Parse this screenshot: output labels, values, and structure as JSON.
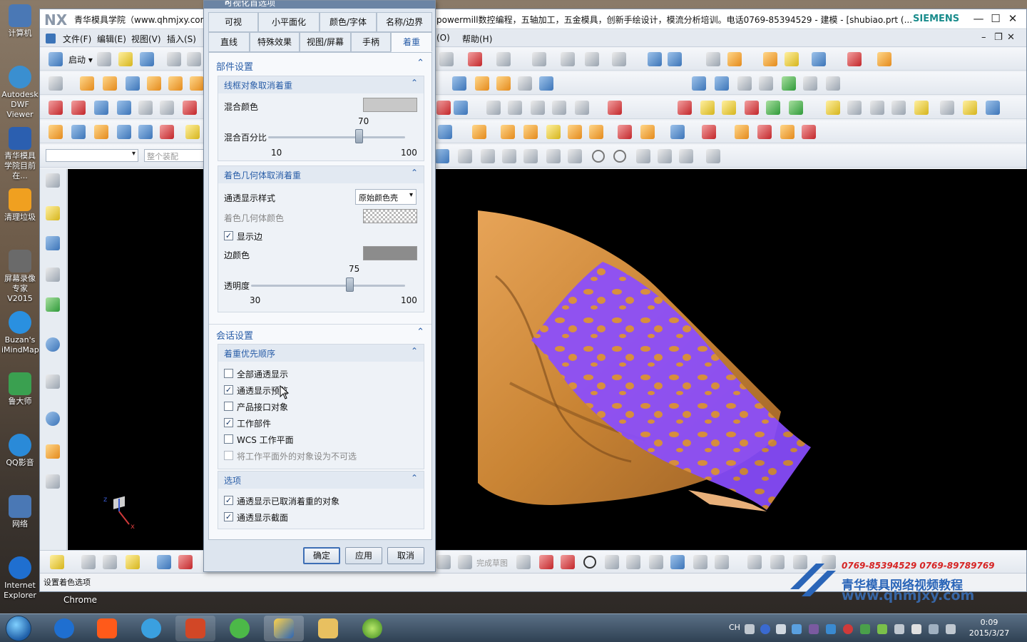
{
  "desktop": {
    "icons": [
      {
        "label": "计算机",
        "color": "#4a78b5"
      },
      {
        "label": "Autodesk DWF Viewer",
        "color": "#3a8fd0"
      },
      {
        "label": "青华模具学院目前在...",
        "color": "#2b5fb0"
      },
      {
        "label": "清理垃圾",
        "color": "#f0a020"
      },
      {
        "label": "屏幕录像专家V2015",
        "color": "#6a6a6a"
      },
      {
        "label": "Buzan's iMindMap",
        "color": "#2a90e0"
      },
      {
        "label": "鲁大师",
        "color": "#3aa050"
      },
      {
        "label": "QQ影音",
        "color": "#2a8ad8"
      },
      {
        "label": "网络",
        "color": "#4a78b5"
      },
      {
        "label": "Internet Explorer",
        "color": "#1f6fd0"
      }
    ],
    "chrome_label": "Chrome"
  },
  "window": {
    "logo": "NX",
    "title_left": "青华模具学院（www.qhmjxy.com",
    "title_right": "powermill数控编程，五轴加工，五金模具，创新手绘设计，模流分析培训。电话0769-85394529 - 建模 - [shubiao.prt  (...",
    "brand": "SIEMENS",
    "min": "—",
    "max": "☐",
    "close": "✕"
  },
  "menu": [
    "文件(F)",
    "编辑(E)",
    "视图(V)",
    "插入(S)"
  ],
  "menu_right": [
    "(O)",
    "帮助(H)"
  ],
  "toolbar": {
    "start_label": "启动 ▾",
    "assembly_placeholder": "整个装配",
    "bottom_sketch_label": "完成草图"
  },
  "status": {
    "text": "设置着色选项"
  },
  "dialog": {
    "title": "可视化首选项",
    "close": "✕",
    "tabs_row1": [
      "可视",
      "小平面化",
      "颜色/字体",
      "名称/边界"
    ],
    "tabs_row2": [
      "直线",
      "特殊效果",
      "视图/屏幕",
      "手柄",
      "着重"
    ],
    "active_tab": "着重",
    "section_part": "部件设置",
    "wire_group": {
      "title": "线框对象取消着重",
      "blend_color_label": "混合颜色",
      "blend_color": "#c8c8c8",
      "blend_pct_label": "混合百分比",
      "blend_value": "70",
      "blend_min": "10",
      "blend_max": "100",
      "blend_fraction": 0.667
    },
    "shade_group": {
      "title": "着色几何体取消着重",
      "style_label": "通透显示样式",
      "style_value": "原始颜色壳",
      "color_label": "着色几何体颜色",
      "show_edges_label": "显示边",
      "edge_color_label": "边颜色",
      "edge_color": "#8c8c8c",
      "transparency_label": "透明度",
      "transparency_value": "75",
      "transparency_min": "30",
      "transparency_max": "100",
      "transparency_fraction": 0.643
    },
    "section_session": "会话设置",
    "priority_group": {
      "title": "着重优先顺序",
      "items": [
        {
          "label": "全部通透显示",
          "checked": false,
          "disabled": false
        },
        {
          "label": "通透显示预览",
          "checked": true,
          "disabled": false
        },
        {
          "label": "产品接口对象",
          "checked": false,
          "disabled": false
        },
        {
          "label": "工作部件",
          "checked": true,
          "disabled": false
        },
        {
          "label": "WCS 工作平面",
          "checked": false,
          "disabled": false
        },
        {
          "label": "将工作平面外的对象设为不可选",
          "checked": false,
          "disabled": true
        }
      ]
    },
    "options_group": {
      "title": "选项",
      "items": [
        {
          "label": "通透显示已取消着重的对象",
          "checked": true
        },
        {
          "label": "通透显示截面",
          "checked": true
        }
      ]
    },
    "buttons": {
      "ok": "确定",
      "apply": "应用",
      "cancel": "取消"
    }
  },
  "watermark": {
    "phones": "0769-85394529  0769-89789769",
    "name": "青华模具网络视频教程",
    "url": "www.qhmjxy.com"
  },
  "taskbar": {
    "ime": "CH",
    "time": "0:09",
    "date": "2015/3/27"
  },
  "model_colors": {
    "body": "#d9903e",
    "highlight": "#8a4dff"
  }
}
